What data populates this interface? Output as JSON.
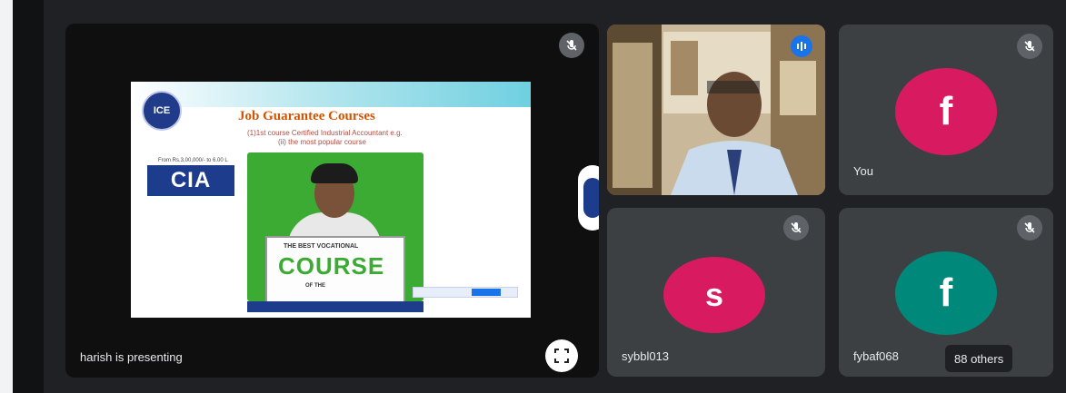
{
  "presentation": {
    "presenter_label": "harish is presenting",
    "slide": {
      "logo_text": "ICE",
      "title": "Job Guarantee Courses",
      "line1": "(1)1st course Certified Industrial Accountant e.g.",
      "line2": "(ii) the most popular course",
      "tag": "From Rs.3,00,000/- to 6.00 L",
      "badge_text": "CIA",
      "board_line1": "THE BEST VOCATIONAL",
      "board_line2": "COURSE",
      "board_line3": "OF THE"
    }
  },
  "participants": [
    {
      "name": "You",
      "initial": "f",
      "color": "#d81b60"
    },
    {
      "name": "sybbl013",
      "initial": "s",
      "color": "#d81b60"
    },
    {
      "name": "fybaf068",
      "initial": "f",
      "color": "#00897b"
    }
  ],
  "others_label": "88 others",
  "icons": {
    "mute": "mic-off-icon",
    "speaking": "audio-wave-icon",
    "fullscreen": "fullscreen-icon"
  },
  "colors": {
    "background": "#202124",
    "tile": "#3c4043",
    "accent": "#1a73e8"
  }
}
